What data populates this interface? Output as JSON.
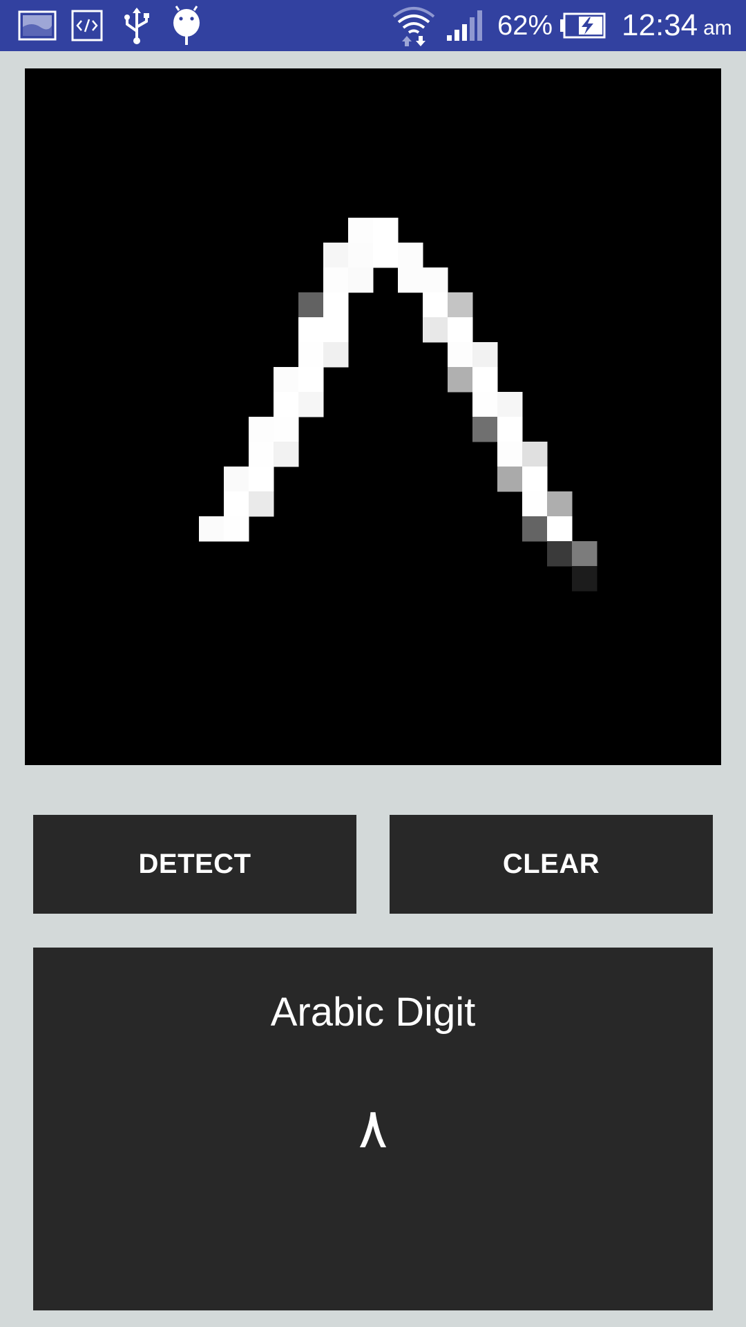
{
  "status_bar": {
    "battery_percent": "62%",
    "time": "12:34",
    "ampm": "am",
    "left_icons": [
      "gallery-icon",
      "code-icon",
      "usb-icon",
      "android-debug-icon"
    ],
    "right_icons": [
      "wifi-icon",
      "signal-icon",
      "battery-charging-icon"
    ]
  },
  "drawing_canvas": {
    "background": "#000000",
    "grid_size": 28,
    "pixels": [
      [
        13,
        6,
        253
      ],
      [
        14,
        6,
        255
      ],
      [
        12,
        7,
        246
      ],
      [
        13,
        7,
        252
      ],
      [
        14,
        7,
        255
      ],
      [
        15,
        7,
        252
      ],
      [
        12,
        8,
        253
      ],
      [
        13,
        8,
        250
      ],
      [
        15,
        8,
        252
      ],
      [
        16,
        8,
        252
      ],
      [
        11,
        9,
        98
      ],
      [
        12,
        9,
        255
      ],
      [
        16,
        9,
        255
      ],
      [
        17,
        9,
        196
      ],
      [
        11,
        10,
        255
      ],
      [
        12,
        10,
        255
      ],
      [
        16,
        10,
        232
      ],
      [
        17,
        10,
        255
      ],
      [
        11,
        11,
        254
      ],
      [
        12,
        11,
        240
      ],
      [
        17,
        11,
        253
      ],
      [
        18,
        11,
        242
      ],
      [
        10,
        12,
        252
      ],
      [
        11,
        12,
        255
      ],
      [
        17,
        12,
        176
      ],
      [
        18,
        12,
        255
      ],
      [
        10,
        13,
        255
      ],
      [
        11,
        13,
        246
      ],
      [
        18,
        13,
        254
      ],
      [
        19,
        13,
        246
      ],
      [
        9,
        14,
        253
      ],
      [
        10,
        14,
        254
      ],
      [
        18,
        14,
        112
      ],
      [
        19,
        14,
        255
      ],
      [
        9,
        15,
        254
      ],
      [
        10,
        15,
        242
      ],
      [
        19,
        15,
        253
      ],
      [
        20,
        15,
        224
      ],
      [
        8,
        16,
        250
      ],
      [
        9,
        16,
        255
      ],
      [
        19,
        16,
        170
      ],
      [
        20,
        16,
        255
      ],
      [
        8,
        17,
        255
      ],
      [
        9,
        17,
        234
      ],
      [
        20,
        17,
        254
      ],
      [
        21,
        17,
        174
      ],
      [
        7,
        18,
        251
      ],
      [
        8,
        18,
        254
      ],
      [
        20,
        18,
        100
      ],
      [
        21,
        18,
        255
      ],
      [
        21,
        19,
        58
      ],
      [
        22,
        19,
        124
      ],
      [
        22,
        20,
        28
      ]
    ]
  },
  "buttons": {
    "detect_label": "DETECT",
    "clear_label": "CLEAR"
  },
  "result": {
    "title": "Arabic Digit",
    "value": "٨"
  },
  "colors": {
    "status_bar": "#3241a0",
    "background": "#d3d9d9",
    "button": "#282828",
    "panel": "#282828",
    "text": "#ffffff"
  }
}
